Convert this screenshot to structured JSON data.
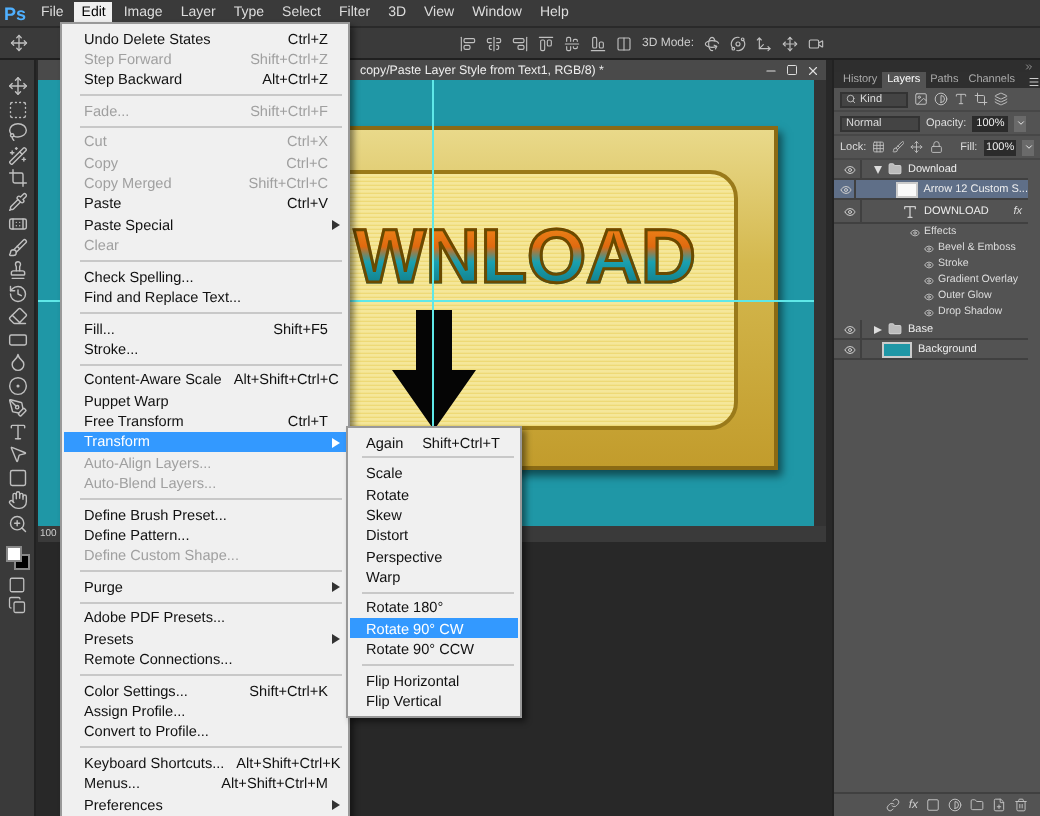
{
  "app": {
    "logo": "Ps"
  },
  "menu_bar": [
    {
      "label": "File",
      "selected": false
    },
    {
      "label": "Edit",
      "selected": true
    },
    {
      "label": "Image",
      "selected": false
    },
    {
      "label": "Layer",
      "selected": false
    },
    {
      "label": "Type",
      "selected": false
    },
    {
      "label": "Select",
      "selected": false
    },
    {
      "label": "Filter",
      "selected": false
    },
    {
      "label": "3D",
      "selected": false
    },
    {
      "label": "View",
      "selected": false
    },
    {
      "label": "Window",
      "selected": false
    },
    {
      "label": "Help",
      "selected": false
    }
  ],
  "options_bar": {
    "mode_label": "3D Mode:"
  },
  "document": {
    "title": "copy/Paste Layer Style from Text1, RGB/8) *",
    "zoom": "100",
    "canvas_text": "WNLOAD"
  },
  "edit_menu": [
    {
      "kind": "item",
      "label": "Undo Delete States",
      "shortcut": "Ctrl+Z",
      "disabled": false,
      "selected": false,
      "submenu": false
    },
    {
      "kind": "item",
      "label": "Step Forward",
      "shortcut": "Shift+Ctrl+Z",
      "disabled": true,
      "selected": false,
      "submenu": false
    },
    {
      "kind": "item",
      "label": "Step Backward",
      "shortcut": "Alt+Ctrl+Z",
      "disabled": false,
      "selected": false,
      "submenu": false
    },
    {
      "kind": "separator"
    },
    {
      "kind": "item",
      "label": "Fade...",
      "shortcut": "Shift+Ctrl+F",
      "disabled": true,
      "selected": false,
      "submenu": false
    },
    {
      "kind": "separator"
    },
    {
      "kind": "item",
      "label": "Cut",
      "shortcut": "Ctrl+X",
      "disabled": true,
      "selected": false,
      "submenu": false
    },
    {
      "kind": "item",
      "label": "Copy",
      "shortcut": "Ctrl+C",
      "disabled": true,
      "selected": false,
      "submenu": false
    },
    {
      "kind": "item",
      "label": "Copy Merged",
      "shortcut": "Shift+Ctrl+C",
      "disabled": true,
      "selected": false,
      "submenu": false
    },
    {
      "kind": "item",
      "label": "Paste",
      "shortcut": "Ctrl+V",
      "disabled": false,
      "selected": false,
      "submenu": false
    },
    {
      "kind": "item",
      "label": "Paste Special",
      "disabled": false,
      "selected": false,
      "submenu": true
    },
    {
      "kind": "item",
      "label": "Clear",
      "disabled": true,
      "selected": false,
      "submenu": false
    },
    {
      "kind": "separator"
    },
    {
      "kind": "item",
      "label": "Check Spelling...",
      "disabled": false,
      "selected": false,
      "submenu": false
    },
    {
      "kind": "item",
      "label": "Find and Replace Text...",
      "disabled": false,
      "selected": false,
      "submenu": false
    },
    {
      "kind": "separator"
    },
    {
      "kind": "item",
      "label": "Fill...",
      "shortcut": "Shift+F5",
      "disabled": false,
      "selected": false,
      "submenu": false
    },
    {
      "kind": "item",
      "label": "Stroke...",
      "disabled": false,
      "selected": false,
      "submenu": false
    },
    {
      "kind": "separator"
    },
    {
      "kind": "item",
      "label": "Content-Aware Scale",
      "shortcut": "Alt+Shift+Ctrl+C",
      "disabled": false,
      "selected": false,
      "submenu": false
    },
    {
      "kind": "item",
      "label": "Puppet Warp",
      "disabled": false,
      "selected": false,
      "submenu": false
    },
    {
      "kind": "item",
      "label": "Free Transform",
      "shortcut": "Ctrl+T",
      "disabled": false,
      "selected": false,
      "submenu": false
    },
    {
      "kind": "item",
      "label": "Transform",
      "disabled": false,
      "selected": true,
      "submenu": true
    },
    {
      "kind": "item",
      "label": "Auto-Align Layers...",
      "disabled": true,
      "selected": false,
      "submenu": false
    },
    {
      "kind": "item",
      "label": "Auto-Blend Layers...",
      "disabled": true,
      "selected": false,
      "submenu": false
    },
    {
      "kind": "separator"
    },
    {
      "kind": "item",
      "label": "Define Brush Preset...",
      "disabled": false,
      "selected": false,
      "submenu": false
    },
    {
      "kind": "item",
      "label": "Define Pattern...",
      "disabled": false,
      "selected": false,
      "submenu": false
    },
    {
      "kind": "item",
      "label": "Define Custom Shape...",
      "disabled": true,
      "selected": false,
      "submenu": false
    },
    {
      "kind": "separator"
    },
    {
      "kind": "item",
      "label": "Purge",
      "disabled": false,
      "selected": false,
      "submenu": true
    },
    {
      "kind": "separator"
    },
    {
      "kind": "item",
      "label": "Adobe PDF Presets...",
      "disabled": false,
      "selected": false,
      "submenu": false
    },
    {
      "kind": "item",
      "label": "Presets",
      "disabled": false,
      "selected": false,
      "submenu": true
    },
    {
      "kind": "item",
      "label": "Remote Connections...",
      "disabled": false,
      "selected": false,
      "submenu": false
    },
    {
      "kind": "separator"
    },
    {
      "kind": "item",
      "label": "Color Settings...",
      "shortcut": "Shift+Ctrl+K",
      "disabled": false,
      "selected": false,
      "submenu": false
    },
    {
      "kind": "item",
      "label": "Assign Profile...",
      "disabled": false,
      "selected": false,
      "submenu": false
    },
    {
      "kind": "item",
      "label": "Convert to Profile...",
      "disabled": false,
      "selected": false,
      "submenu": false
    },
    {
      "kind": "separator"
    },
    {
      "kind": "item",
      "label": "Keyboard Shortcuts...",
      "shortcut": "Alt+Shift+Ctrl+K",
      "disabled": false,
      "selected": false,
      "submenu": false
    },
    {
      "kind": "item",
      "label": "Menus...",
      "shortcut": "Alt+Shift+Ctrl+M",
      "disabled": false,
      "selected": false,
      "submenu": false
    },
    {
      "kind": "item",
      "label": "Preferences",
      "disabled": false,
      "selected": false,
      "submenu": true
    }
  ],
  "transform_menu": [
    {
      "kind": "item",
      "label": "Again",
      "shortcut": "Shift+Ctrl+T",
      "disabled": false,
      "selected": false,
      "submenu": false
    },
    {
      "kind": "separator"
    },
    {
      "kind": "item",
      "label": "Scale",
      "disabled": false,
      "selected": false,
      "submenu": false
    },
    {
      "kind": "item",
      "label": "Rotate",
      "disabled": false,
      "selected": false,
      "submenu": false
    },
    {
      "kind": "item",
      "label": "Skew",
      "disabled": false,
      "selected": false,
      "submenu": false
    },
    {
      "kind": "item",
      "label": "Distort",
      "disabled": false,
      "selected": false,
      "submenu": false
    },
    {
      "kind": "item",
      "label": "Perspective",
      "disabled": false,
      "selected": false,
      "submenu": false
    },
    {
      "kind": "item",
      "label": "Warp",
      "disabled": false,
      "selected": false,
      "submenu": false
    },
    {
      "kind": "separator"
    },
    {
      "kind": "item",
      "label": "Rotate 180°",
      "disabled": false,
      "selected": false,
      "submenu": false
    },
    {
      "kind": "item",
      "label": "Rotate 90° CW",
      "disabled": false,
      "selected": true,
      "submenu": false
    },
    {
      "kind": "item",
      "label": "Rotate 90° CCW",
      "disabled": false,
      "selected": false,
      "submenu": false
    },
    {
      "kind": "separator"
    },
    {
      "kind": "item",
      "label": "Flip Horizontal",
      "disabled": false,
      "selected": false,
      "submenu": false
    },
    {
      "kind": "item",
      "label": "Flip Vertical",
      "disabled": false,
      "selected": false,
      "submenu": false
    }
  ],
  "layers_panel": {
    "tabs": [
      {
        "label": "History",
        "selected": false
      },
      {
        "label": "Layers",
        "selected": true
      },
      {
        "label": "Paths",
        "selected": false
      },
      {
        "label": "Channels",
        "selected": false
      }
    ],
    "filter": "Kind",
    "blend_mode": "Normal",
    "opacity_label": "Opacity:",
    "opacity": "100%",
    "lock_label": "Lock:",
    "fill_label": "Fill:",
    "fill": "100%",
    "layers": [
      {
        "kind": "group",
        "name": "Download",
        "expanded": true,
        "selected": false,
        "children": [
          {
            "kind": "shape",
            "name": "Arrow 12 Custom S...",
            "selected": true
          },
          {
            "kind": "text",
            "name": "DOWNLOAD",
            "selected": false,
            "fx_badge": "fx",
            "effects_label": "Effects",
            "effects": [
              "Bevel & Emboss",
              "Stroke",
              "Gradient Overlay",
              "Outer Glow",
              "Drop Shadow"
            ]
          }
        ]
      },
      {
        "kind": "group",
        "name": "Base",
        "expanded": false,
        "selected": false
      },
      {
        "kind": "fill",
        "name": "Background",
        "selected": false
      }
    ],
    "footer_fx": "fx"
  }
}
